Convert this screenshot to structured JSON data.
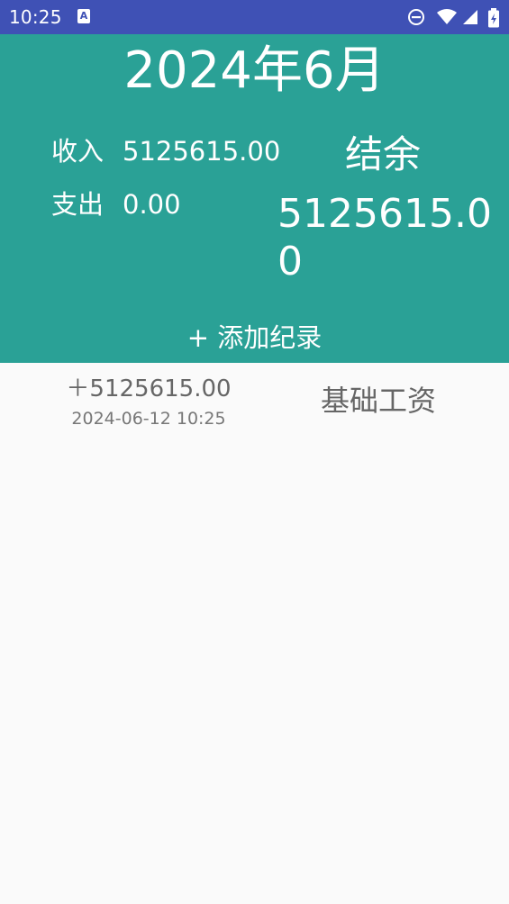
{
  "status_bar": {
    "time": "10:25",
    "app_badge": "A",
    "icons": [
      "app-notification-icon",
      "do-not-disturb-icon",
      "wifi-icon",
      "cell-signal-icon",
      "battery-icon"
    ],
    "color": "#3f51b5"
  },
  "header": {
    "month": "2024年6月",
    "income_label": "收入",
    "income_value": "5125615.00",
    "expense_label": "支出",
    "expense_value": "0.00",
    "balance_label": "结余",
    "balance_value": "5125615.00",
    "add_button": "+ 添加纪录",
    "color": "#2aa196"
  },
  "records": [
    {
      "amount": "＋5125615.00",
      "time": "2024-06-12 10:25",
      "category": "基础工资"
    }
  ]
}
